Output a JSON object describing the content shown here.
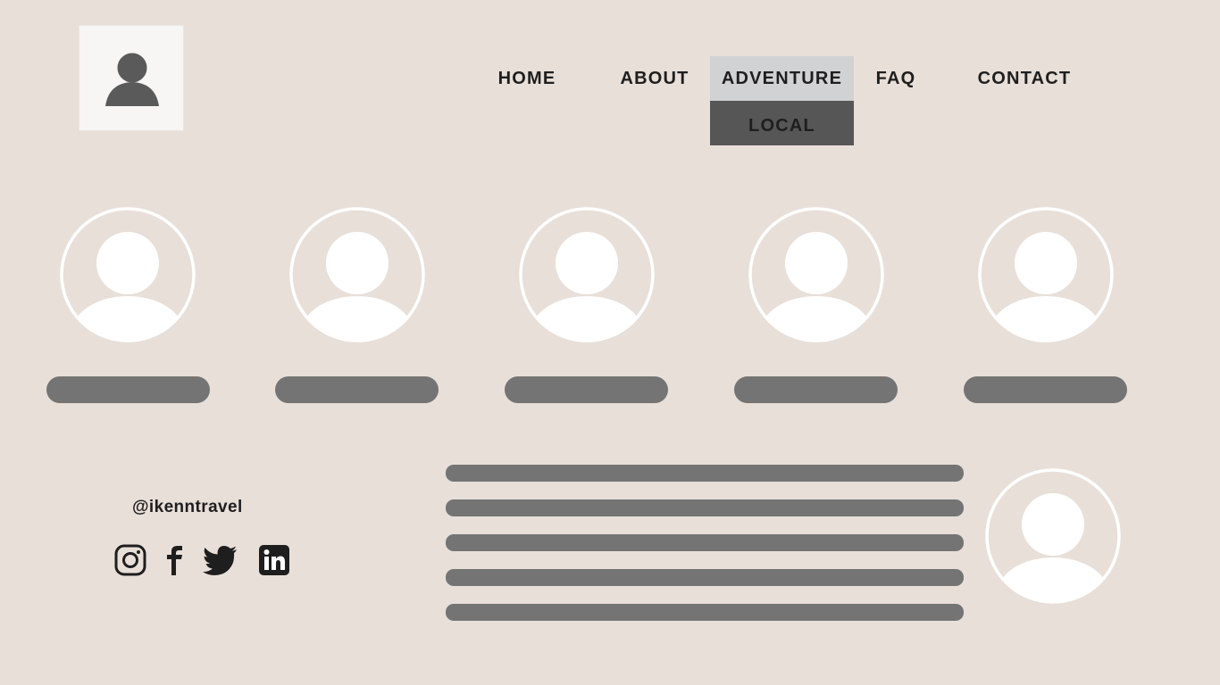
{
  "nav": {
    "items": [
      {
        "label": "HOME",
        "active": false
      },
      {
        "label": "ABOUT",
        "active": false
      },
      {
        "label": "ADVENTURE",
        "active": true
      },
      {
        "label": "FAQ",
        "active": false
      },
      {
        "label": "CONTACT",
        "active": false
      }
    ],
    "dropdown": {
      "label": "LOCAL"
    }
  },
  "logo": {
    "icon": "user-icon"
  },
  "team": {
    "members": [
      {
        "icon": "user-avatar-icon"
      },
      {
        "icon": "user-avatar-icon"
      },
      {
        "icon": "user-avatar-icon"
      },
      {
        "icon": "user-avatar-icon"
      },
      {
        "icon": "user-avatar-icon"
      }
    ]
  },
  "footer": {
    "handle": "@ikenntravel",
    "social": [
      "instagram-icon",
      "facebook-icon",
      "twitter-icon",
      "linkedin-icon"
    ]
  },
  "colors": {
    "background": "#e8dfd9",
    "nav_active": "#d1d2d4",
    "dropdown": "#565656",
    "placeholder": "#747474",
    "text": "#1f1e1e"
  }
}
